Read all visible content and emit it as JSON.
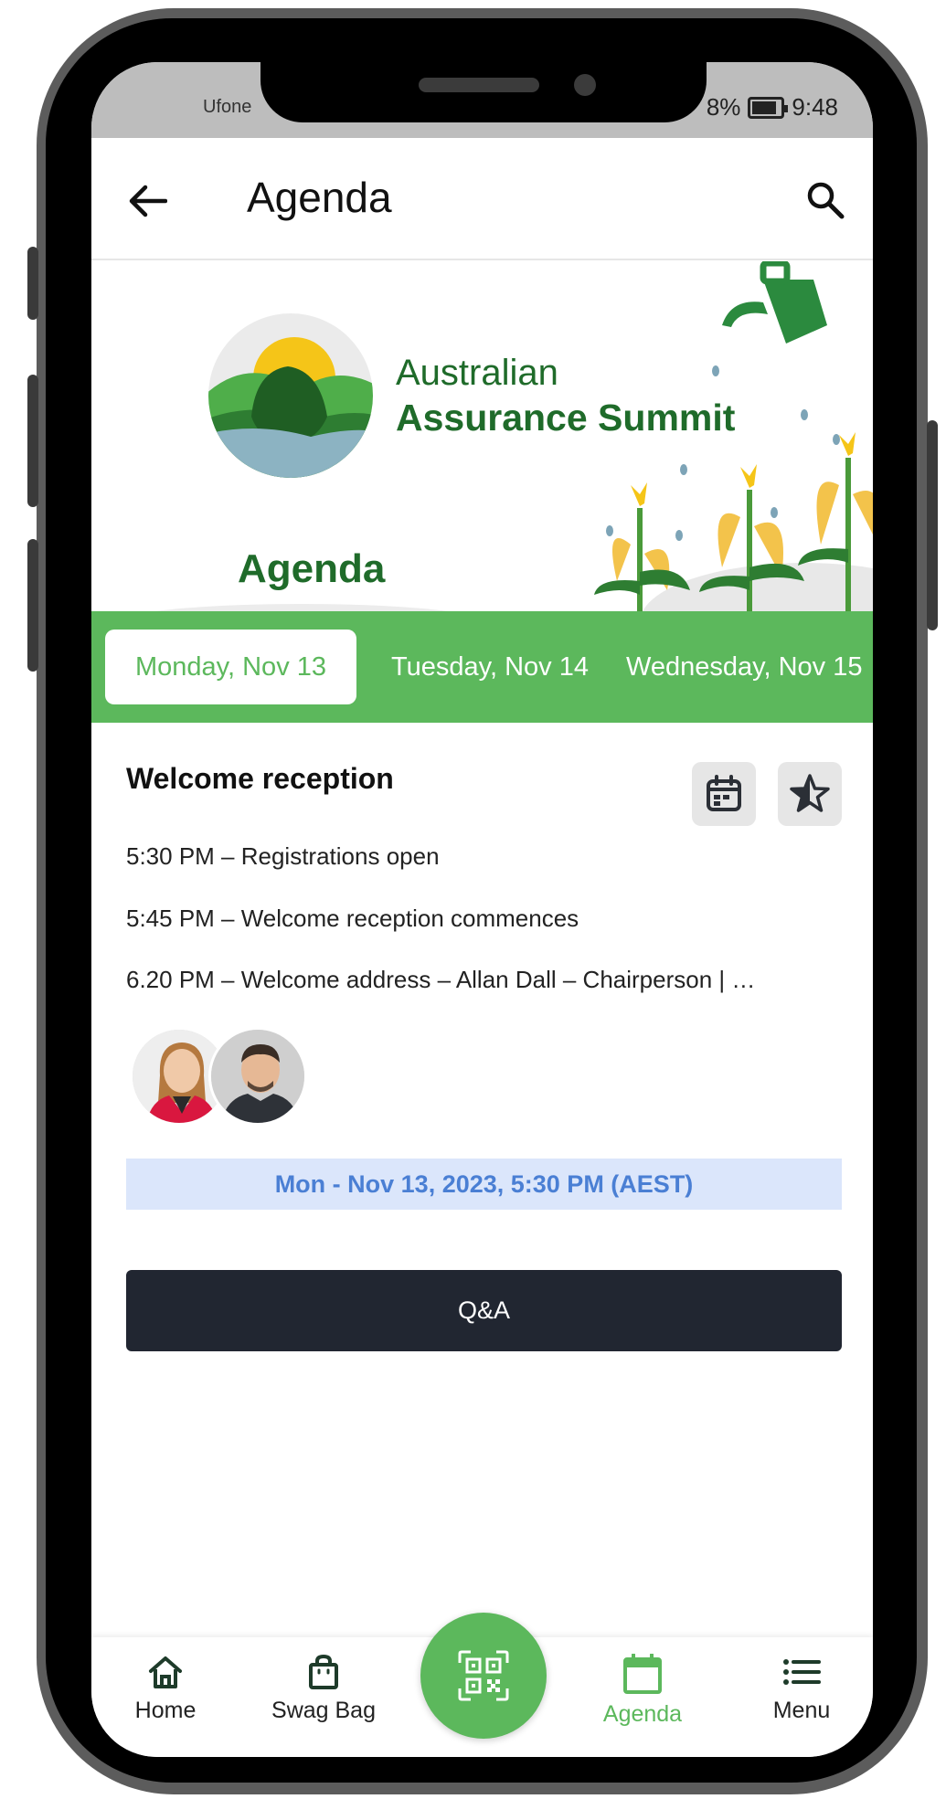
{
  "status_bar": {
    "carrier": "Ufone",
    "battery": "8%",
    "time": "9:48"
  },
  "header": {
    "title": "Agenda"
  },
  "banner": {
    "brand_line1": "Australian",
    "brand_line2": "Assurance Summit",
    "title": "Agenda"
  },
  "day_tabs": [
    {
      "label": "Monday, Nov 13"
    },
    {
      "label": "Tuesday, Nov 14"
    },
    {
      "label": "Wednesday, Nov 15"
    }
  ],
  "session": {
    "title": "Welcome reception",
    "lines": [
      "5:30 PM – Registrations open",
      "5:45 PM – Welcome reception commences",
      "6.20 PM – Welcome address – Allan Dall – Chairperson | …"
    ],
    "datetime": "Mon - Nov 13, 2023, 5:30 PM (AEST)",
    "qa_label": "Q&A"
  },
  "bottom_nav": [
    {
      "label": "Home",
      "icon": "home-icon"
    },
    {
      "label": "Swag Bag",
      "icon": "bag-icon"
    },
    {
      "label": "Agenda",
      "icon": "calendar-icon"
    },
    {
      "label": "Menu",
      "icon": "menu-icon"
    }
  ],
  "colors": {
    "accent": "#5cb85c",
    "brand_green": "#1f6b2a",
    "dark_button": "#212631",
    "date_bar_bg": "#dbe6fb",
    "date_bar_text": "#4a7fd4"
  }
}
